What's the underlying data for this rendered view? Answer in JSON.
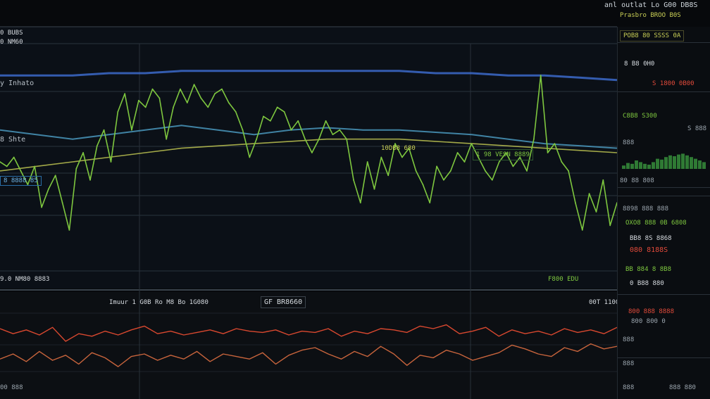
{
  "header": {
    "title_line1": "anl outlat  Lo  G00 DB8S",
    "title_line2": "Prasbro BROO B0S"
  },
  "main_chart": {
    "label_a": "0 BUBS",
    "label_b": "0 NM60",
    "label_c": "y Inhato",
    "label_d": "8 Shte",
    "mid_label": "10DB8 680",
    "mid_box": "1 98 VESN 8889",
    "left_box": "8 8888 85",
    "bottom_left": "9.0 NM80 8883",
    "bottom_right": "F800 EDU"
  },
  "sub_chart": {
    "header_text": "Imuur   1 G0B  Ro   M8  Bo   1G080",
    "box_label": "GF BR8660",
    "right_label": "00T  1100",
    "bottom_label": "00 888"
  },
  "side_panel": {
    "top_box": "POB8 80 SSSS 0A",
    "row1": "8 B8 0H0",
    "row2": "S 1800 0B00",
    "row3": "C8B8 S300",
    "row4": "S 888",
    "row5": "888",
    "row6": "80 88 808",
    "row7": "8898 888 888",
    "row8": "OXO8 888 0B 6808",
    "row9": "BB8 8S 8868",
    "row10": "080 8188S",
    "row11": "BB 884 8 8B8",
    "row12": "0 B88 880",
    "row13": "800 888 8888",
    "row14": "800 800 0",
    "row15": "888",
    "row16": "888",
    "row17": "888",
    "row18": "888 880"
  },
  "colors": {
    "green": "#7ec73f",
    "yellow_green": "#c9cf55",
    "blue": "#3f6fd6",
    "cyan": "#4ea0c8",
    "red": "#d9482f",
    "orange": "#c8643c"
  },
  "chart_data": [
    {
      "type": "line",
      "series": [
        {
          "values": [
            0.48,
            0.46,
            0.5,
            0.44,
            0.38,
            0.46,
            0.28,
            0.36,
            0.42,
            0.3,
            0.18,
            0.45,
            0.52,
            0.4,
            0.55,
            0.62,
            0.48,
            0.7,
            0.78,
            0.62,
            0.75,
            0.72,
            0.8,
            0.76,
            0.58,
            0.72,
            0.8,
            0.74,
            0.82,
            0.76,
            0.72,
            0.78,
            0.8,
            0.74,
            0.7,
            0.62,
            0.5,
            0.58,
            0.68,
            0.66,
            0.72,
            0.7,
            0.62,
            0.66,
            0.58,
            0.52,
            0.58,
            0.66,
            0.6,
            0.62,
            0.58,
            0.4,
            0.3,
            0.48,
            0.36,
            0.5,
            0.42,
            0.56,
            0.5,
            0.54,
            0.44,
            0.38,
            0.3,
            0.46,
            0.4,
            0.44,
            0.52,
            0.48,
            0.56,
            0.5,
            0.44,
            0.4,
            0.48,
            0.52,
            0.46,
            0.5,
            0.44,
            0.58,
            0.86,
            0.52,
            0.56,
            0.48,
            0.44,
            0.3,
            0.18,
            0.34,
            0.26,
            0.4,
            0.2,
            0.3
          ]
        },
        {
          "values": [
            0.86,
            0.86,
            0.86,
            0.87,
            0.87,
            0.88,
            0.88,
            0.88,
            0.88,
            0.88,
            0.88,
            0.88,
            0.87,
            0.87,
            0.86,
            0.86,
            0.85,
            0.84
          ]
        },
        {
          "values": [
            0.62,
            0.6,
            0.58,
            0.6,
            0.62,
            0.64,
            0.62,
            0.6,
            0.62,
            0.63,
            0.62,
            0.62,
            0.61,
            0.6,
            0.58,
            0.56,
            0.55,
            0.54
          ]
        },
        {
          "values": [
            0.44,
            0.46,
            0.48,
            0.5,
            0.52,
            0.54,
            0.55,
            0.56,
            0.57,
            0.58,
            0.58,
            0.58,
            0.57,
            0.56,
            0.55,
            0.54,
            0.53,
            0.52
          ]
        }
      ]
    },
    {
      "type": "line",
      "series": [
        {
          "values": [
            0.7,
            0.62,
            0.68,
            0.6,
            0.72,
            0.5,
            0.62,
            0.58,
            0.66,
            0.6,
            0.68,
            0.74,
            0.62,
            0.66,
            0.6,
            0.64,
            0.68,
            0.62,
            0.7,
            0.66,
            0.64,
            0.68,
            0.6,
            0.66,
            0.64,
            0.7,
            0.58,
            0.66,
            0.62,
            0.7,
            0.68,
            0.64,
            0.74,
            0.7,
            0.76,
            0.62,
            0.66,
            0.72,
            0.58,
            0.68,
            0.62,
            0.66,
            0.6,
            0.7,
            0.64,
            0.68,
            0.62,
            0.72
          ]
        },
        {
          "values": [
            0.22,
            0.3,
            0.18,
            0.34,
            0.2,
            0.28,
            0.14,
            0.32,
            0.24,
            0.1,
            0.26,
            0.3,
            0.2,
            0.28,
            0.22,
            0.34,
            0.18,
            0.3,
            0.26,
            0.22,
            0.32,
            0.14,
            0.28,
            0.36,
            0.4,
            0.3,
            0.22,
            0.34,
            0.26,
            0.42,
            0.3,
            0.12,
            0.28,
            0.24,
            0.36,
            0.3,
            0.2,
            0.26,
            0.32,
            0.44,
            0.38,
            0.3,
            0.26,
            0.4,
            0.34,
            0.46,
            0.38,
            0.42
          ]
        }
      ]
    }
  ]
}
